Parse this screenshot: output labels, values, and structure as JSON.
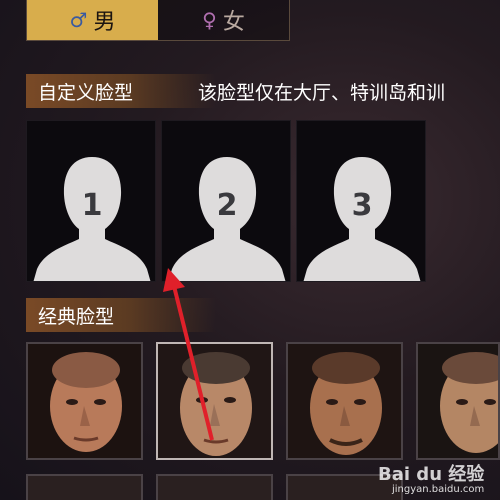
{
  "gender_tabs": [
    {
      "symbol": "♂",
      "label": "男",
      "active": true
    },
    {
      "symbol": "♀",
      "label": "女",
      "active": false
    }
  ],
  "custom_section": {
    "title": "自定义脸型",
    "note": "该脸型仅在大厅、特训岛和训",
    "slots": [
      "1",
      "2",
      "3"
    ]
  },
  "classic_section": {
    "title": "经典脸型"
  },
  "watermark": {
    "brand": "Bai du 经验",
    "url": "jingyan.baidu.com"
  },
  "colors": {
    "accent": "#d8ad4c",
    "arrow": "#e0202a"
  }
}
